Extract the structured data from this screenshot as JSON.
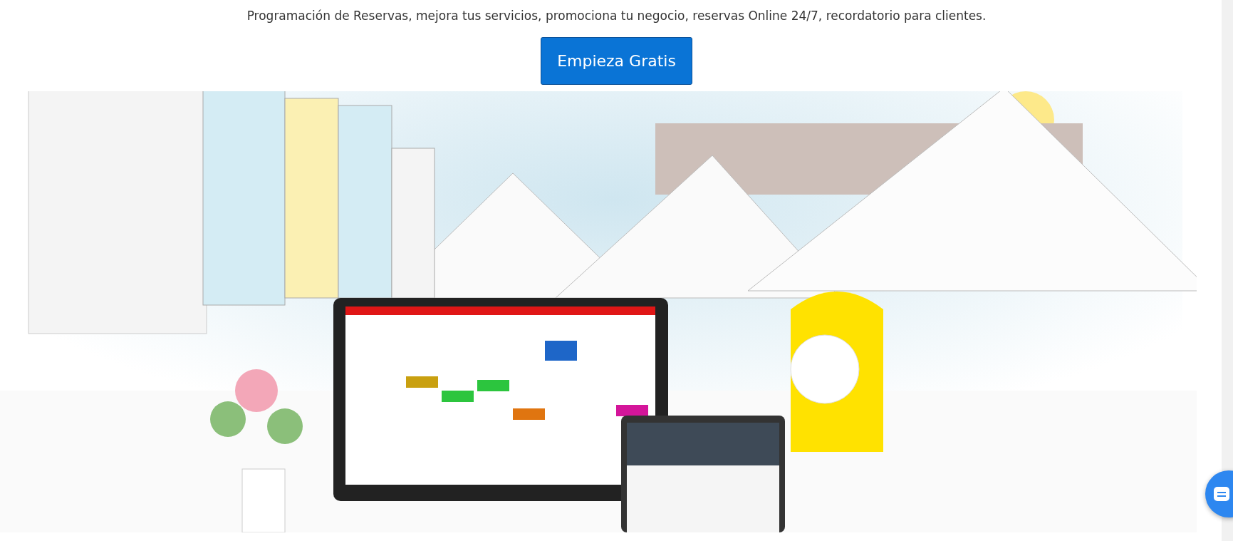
{
  "hero": {
    "subtitle": "Programación de Reservas, mejora tus servicios, promociona tu negocio, reservas Online 24/7, recordatorio para clientes.",
    "cta_button": "Empieza Gratis"
  }
}
